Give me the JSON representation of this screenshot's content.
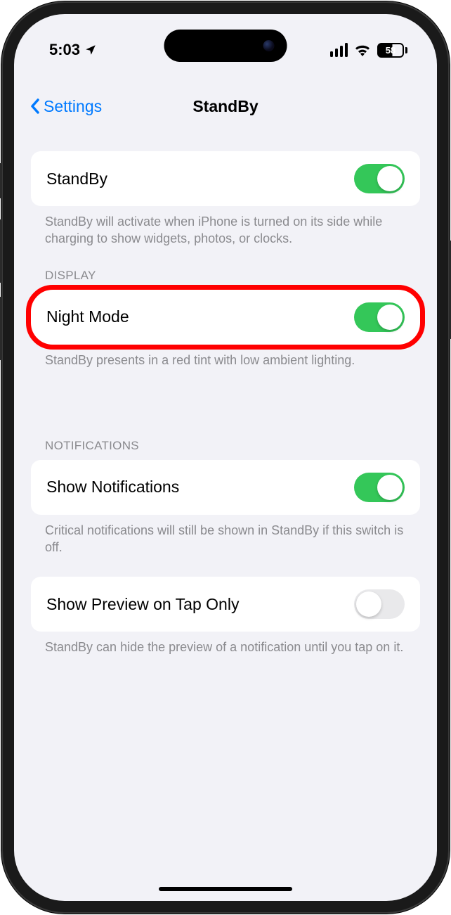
{
  "status": {
    "time": "5:03",
    "battery": "58"
  },
  "nav": {
    "back_label": "Settings",
    "title": "StandBy"
  },
  "groups": {
    "standby": {
      "label": "StandBy",
      "footer": "StandBy will activate when iPhone is turned on its side while charging to show widgets, photos, or clocks.",
      "enabled": true
    },
    "display": {
      "header": "DISPLAY",
      "night_mode": {
        "label": "Night Mode",
        "enabled": true,
        "footer": "StandBy presents in a red tint with low ambient lighting."
      }
    },
    "notifications": {
      "header": "NOTIFICATIONS",
      "show_notifications": {
        "label": "Show Notifications",
        "enabled": true,
        "footer": "Critical notifications will still be shown in StandBy if this switch is off."
      },
      "show_preview": {
        "label": "Show Preview on Tap Only",
        "enabled": false,
        "footer": "StandBy can hide the preview of a notification until you tap on it."
      }
    }
  }
}
